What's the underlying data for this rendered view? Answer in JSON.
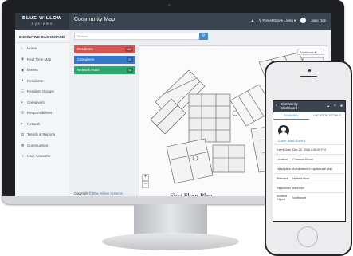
{
  "brand": {
    "name": "BLUE WILLOW",
    "sub": "Systems"
  },
  "header": {
    "title": "Community Map",
    "community": "Forest Grove Living",
    "user": "Jane Doe"
  },
  "sidebar": {
    "heading": "EXECUTIVE DASHBOARD",
    "items": [
      {
        "label": "Home",
        "icon": "home-icon",
        "glyph": "⌂"
      },
      {
        "label": "Real Time Map",
        "icon": "map-pin-icon",
        "glyph": "◉"
      },
      {
        "label": "Events",
        "icon": "events-icon",
        "glyph": "▣"
      },
      {
        "label": "Residents",
        "icon": "residents-icon",
        "glyph": "♟"
      },
      {
        "label": "Resident Groups",
        "icon": "groups-icon",
        "glyph": "☷"
      },
      {
        "label": "Caregivers",
        "icon": "caregivers-icon",
        "glyph": "♥"
      },
      {
        "label": "Responsibilities",
        "icon": "responsibilities-icon",
        "glyph": "☰"
      },
      {
        "label": "Network",
        "icon": "network-icon",
        "glyph": "⌗"
      },
      {
        "label": "Trends & Reports",
        "icon": "chart-icon",
        "glyph": "▤"
      },
      {
        "label": "Communities",
        "icon": "communities-icon",
        "glyph": "▦"
      },
      {
        "label": "User Accounts",
        "icon": "user-accounts-icon",
        "glyph": "☺"
      }
    ]
  },
  "search": {
    "placeholder": "Search"
  },
  "stats": {
    "residents": {
      "label": "Residents",
      "count": "102"
    },
    "caregivers": {
      "label": "Caregivers",
      "count": "22"
    },
    "hubs": {
      "label": "Network Hubs",
      "count": "14"
    }
  },
  "map": {
    "floor_label": "First Floor Plan",
    "select_value": "Northeast"
  },
  "footer": {
    "copyright": "Copyright © ",
    "company": "Blue Willow Systems"
  },
  "phone": {
    "title": "Community Dashboard",
    "tabs": [
      "SUMMARY",
      "LOCATION DETAILS"
    ],
    "alert": "Care Wait Event",
    "details": [
      {
        "key": "Event Date",
        "value": "Dec 26, 2015 4:50:00 PM"
      },
      {
        "key": "Location",
        "value": "Common Room"
      },
      {
        "key": "Description",
        "value": "Administered regular care plan"
      },
      {
        "key": "Resident",
        "value": "Herbert Hunt"
      },
      {
        "key": "Responder",
        "value": "Irma Bell"
      },
      {
        "key": "Incident Report",
        "value": "Northpoint"
      }
    ]
  },
  "colors": {
    "residents": "#d9534f",
    "caregivers": "#3478c9",
    "hubs": "#27a96f",
    "accent": "#2f8fd8",
    "topbar": "#3a4450"
  }
}
